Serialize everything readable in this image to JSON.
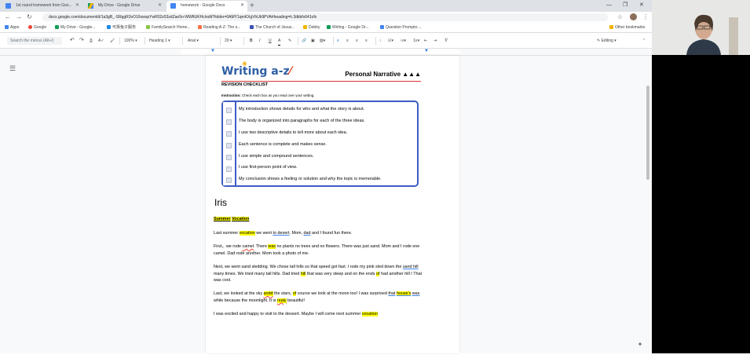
{
  "browser": {
    "tabs": [
      {
        "label": "1st round homework from Goo...",
        "active": false
      },
      {
        "label": "My Drive - Google Drive",
        "active": false
      },
      {
        "label": "homework - Google Docs",
        "active": true
      }
    ],
    "address": "docs.google.com/document/d/1a3gB_-SRggR3vO10owspYwR02z53zdZae5n-WWftUKHc/edit?folder=0AMY1qmKXgVhUk9PVA#heading=h.3dkbfx641ofx",
    "bookmarks": [
      "Apps",
      "Google",
      "My Drive - Google...",
      "可靠兔子服务",
      "FamilySearch Home...",
      "Reading A-Z: The o...",
      "The Church of Jesus...",
      "Debby",
      "Writing - Google Dr...",
      "Question Prompts:..."
    ],
    "other_bookmarks": "Other bookmarks"
  },
  "docs_toolbar": {
    "search_placeholder": "Search the menus (Alt+/)",
    "zoom": "100%",
    "style": "Heading 1",
    "font": "Arial",
    "font_size": "20",
    "mode": "Editing"
  },
  "worksheet": {
    "logo": "Writing a-z",
    "type": "Personal Narrative ▲▲▲",
    "subtitle": "REVISION CHECKLIST",
    "instruction_label": "Instruction:",
    "instruction_text": "Check each box as you read over your writing.",
    "items": [
      "My introduction shows details for who and what the story is about.",
      "The body is organized into paragraphs for each of the three ideas.",
      "I use two descriptive details to tell more about each idea.",
      "Each sentence is complete and makes sense.",
      "I use simple and compound sentences.",
      "I use first-person point of view.",
      "My conclusion shows a feeling or solution and why the topic is memorable."
    ]
  },
  "document": {
    "author": "Iris",
    "title_a": "Summer",
    "title_b": "Vocation",
    "p1": {
      "a": "Last summer ",
      "b": "vocation",
      "c": " we went ",
      "d": "to desert",
      "e": ". Mom, ",
      "f": "dad",
      "g": " and I found fun there."
    },
    "p2": {
      "a": "First，we rode ",
      "b": "camel",
      "c": ". There ",
      "d": "was",
      "e": " no plants no trees and no flowers. There was just sand. Mom and I rode one camel. Dad rode another. Mom took a photo of me."
    },
    "p3": {
      "a": "Next, we went sand sledding. We chose tall hills so that speed got fast. I rode my pink sled down the ",
      "b": "sand hill",
      "c": " many times. We tried many tall hills. Dad tried ",
      "d": "hill",
      "e": " that was very steep and on the ends ",
      "f": "of",
      "g": " had another hill I That was cool."
    },
    "p4": {
      "a": "Last, we looked at the sky ",
      "b": "andd",
      "c": " the stars, ",
      "d": "of",
      "e": " course we look at the moon too! I was surprised ",
      "f": "that",
      "g": " ",
      "h": "house's",
      "i": " ",
      "j": "was",
      "k": " while because the moonlight. It is ",
      "l": "realy",
      "m": " beautiful!"
    },
    "p5": {
      "a": "I was excited and happy to visit to the dessert. Maybe I will come next summer ",
      "b": "vocation"
    }
  },
  "colors": {
    "accent": "#1a73e8",
    "highlight": "#ffff00",
    "checklist_border": "#3e5cc5"
  }
}
